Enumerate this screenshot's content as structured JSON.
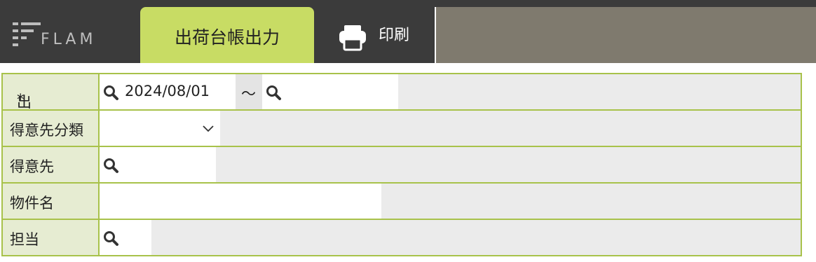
{
  "header": {
    "logo_text": "FLAM",
    "active_tab": "出荷台帳出力",
    "print_label": "印刷"
  },
  "form": {
    "rows": [
      {
        "label": "出荷日",
        "required_mark": "*",
        "from_value": "2024/08/01",
        "range_separator": "〜",
        "to_value": ""
      },
      {
        "label": "得意先分類",
        "selected_value": ""
      },
      {
        "label": "得意先",
        "value": ""
      },
      {
        "label": "物件名",
        "value": ""
      },
      {
        "label": "担当",
        "value": ""
      }
    ]
  },
  "colors": {
    "topbar": "#3b3b3b",
    "active_tab": "#c8dc64",
    "right_fill": "#7f7a6e",
    "row_border": "#a8c24a",
    "label_bg": "#e6ecd2",
    "required": "#e02020"
  },
  "icons": [
    "search-icon",
    "printer-icon",
    "chevron-down-icon",
    "flam-logo"
  ]
}
